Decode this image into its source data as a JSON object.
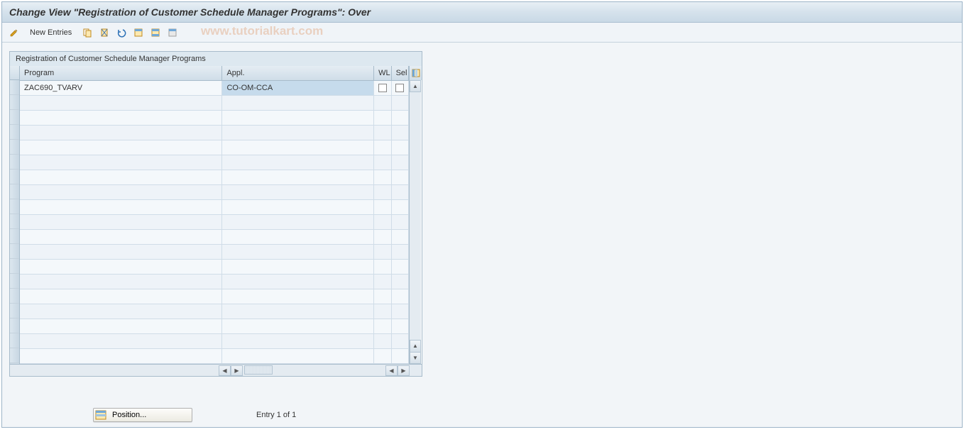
{
  "header": {
    "title": "Change View \"Registration of Customer Schedule Manager Programs\": Over"
  },
  "toolbar": {
    "new_entries_label": "New Entries"
  },
  "watermark": "www.tutorialkart.com",
  "panel": {
    "title": "Registration of Customer Schedule Manager Programs",
    "columns": {
      "program": "Program",
      "appl": "Appl.",
      "wl": "WL",
      "sel": "Sel"
    }
  },
  "rows": [
    {
      "program": "ZAC690_TVARV",
      "appl": "CO-OM-CCA",
      "wl": false,
      "sel": false
    }
  ],
  "empty_row_count": 18,
  "footer": {
    "position_label": "Position...",
    "entry_text": "Entry 1 of 1"
  }
}
